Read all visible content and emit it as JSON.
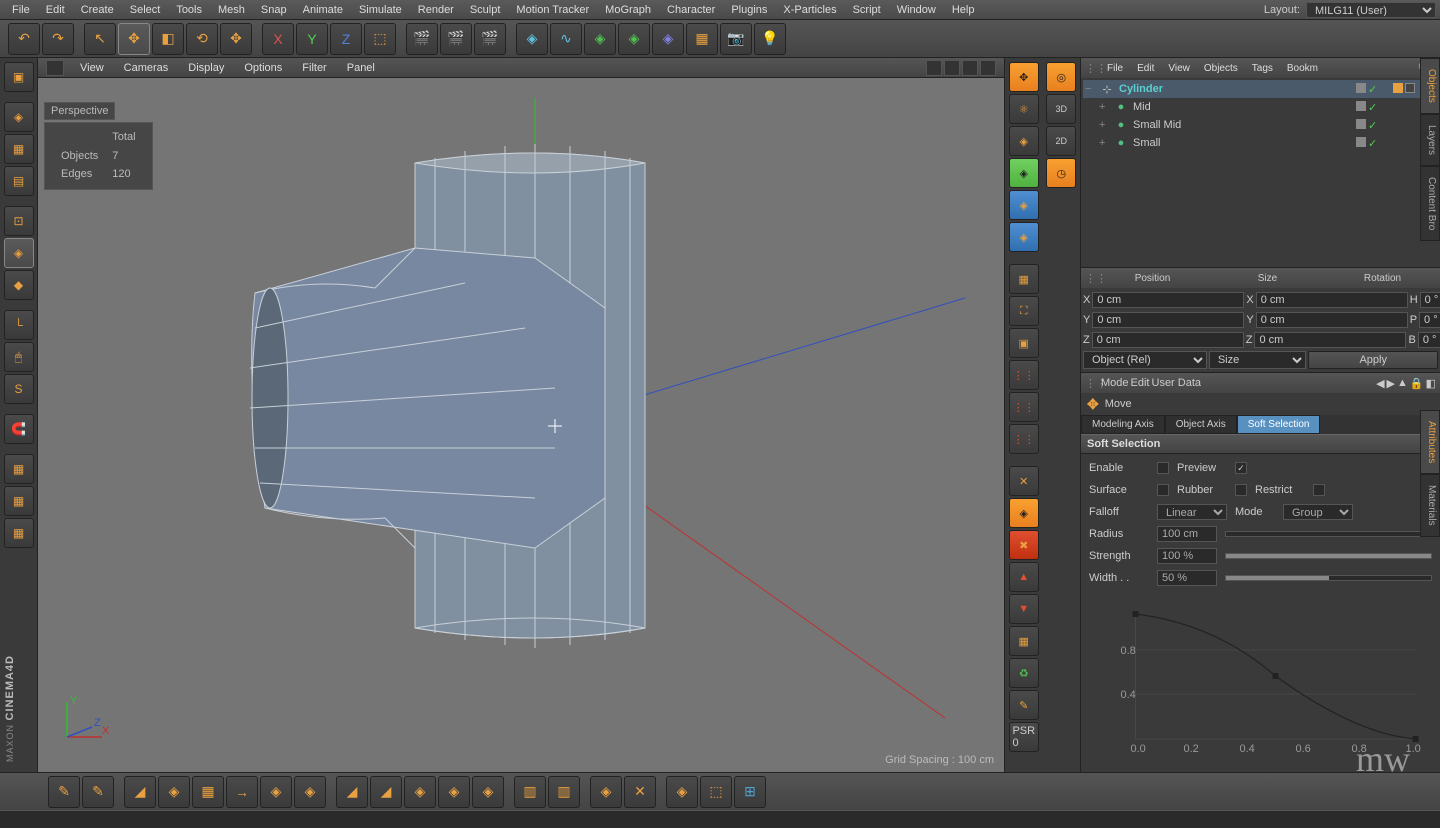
{
  "menubar": [
    "File",
    "Edit",
    "Create",
    "Select",
    "Tools",
    "Mesh",
    "Snap",
    "Animate",
    "Simulate",
    "Render",
    "Sculpt",
    "Motion Tracker",
    "MoGraph",
    "Character",
    "Plugins",
    "X-Particles",
    "Script",
    "Window",
    "Help"
  ],
  "layout": {
    "label": "Layout:",
    "value": "MILG11 (User)"
  },
  "viewport": {
    "menus": [
      "View",
      "Cameras",
      "Display",
      "Options",
      "Filter",
      "Panel"
    ],
    "label": "Perspective",
    "stats": {
      "header_total": "Total",
      "objects_label": "Objects",
      "objects": "7",
      "edges_label": "Edges",
      "edges": "120"
    },
    "footer": "Grid Spacing : 100 cm",
    "axes": {
      "x": "X",
      "y": "Y",
      "z": "Z"
    }
  },
  "obj_manager": {
    "menus": [
      "File",
      "Edit",
      "View",
      "Objects",
      "Tags",
      "Bookm"
    ],
    "tree": [
      {
        "name": "Cylinder",
        "selected": true,
        "indent": 0,
        "expand": "−",
        "cls": "cyan"
      },
      {
        "name": "Mid",
        "selected": false,
        "indent": 1,
        "expand": "+",
        "cls": ""
      },
      {
        "name": "Small Mid",
        "selected": false,
        "indent": 1,
        "expand": "+",
        "cls": ""
      },
      {
        "name": "Small",
        "selected": false,
        "indent": 1,
        "expand": "+",
        "cls": ""
      }
    ]
  },
  "coords": {
    "headers": [
      "Position",
      "Size",
      "Rotation"
    ],
    "rows": [
      {
        "a": "X",
        "av": "0 cm",
        "b": "X",
        "bv": "0 cm",
        "c": "H",
        "cv": "0 °"
      },
      {
        "a": "Y",
        "av": "0 cm",
        "b": "Y",
        "bv": "0 cm",
        "c": "P",
        "cv": "0 °"
      },
      {
        "a": "Z",
        "av": "0 cm",
        "b": "Z",
        "bv": "0 cm",
        "c": "B",
        "cv": "0 °"
      }
    ],
    "mode": "Object (Rel)",
    "size_mode": "Size",
    "apply": "Apply"
  },
  "attr": {
    "menus": [
      "Mode",
      "Edit",
      "User Data"
    ],
    "tool_name": "Move",
    "tabs": [
      "Modeling Axis",
      "Object Axis",
      "Soft Selection"
    ],
    "active_tab": 2,
    "section": "Soft Selection",
    "enable": "Enable",
    "preview": "Preview",
    "surface": "Surface",
    "rubber": "Rubber",
    "restrict": "Restrict",
    "falloff": "Falloff",
    "falloff_val": "Linear",
    "mode_lbl": "Mode",
    "mode_val": "Group",
    "radius": "Radius",
    "radius_val": "100 cm",
    "strength": "Strength",
    "strength_val": "100 %",
    "width": "Width . .",
    "width_val": "50 %",
    "curve_y": [
      "0.8",
      "0.4"
    ],
    "curve_x": [
      "0.0",
      "0.2",
      "0.4",
      "0.6",
      "0.8",
      "1.0"
    ]
  },
  "right_tabs": [
    "Objects",
    "Layers",
    "Content Bro",
    "Attributes",
    "Materials"
  ],
  "rt_labels": {
    "3d": "3D",
    "2d": "2D",
    "psr": "PSR",
    "zero": "0"
  }
}
